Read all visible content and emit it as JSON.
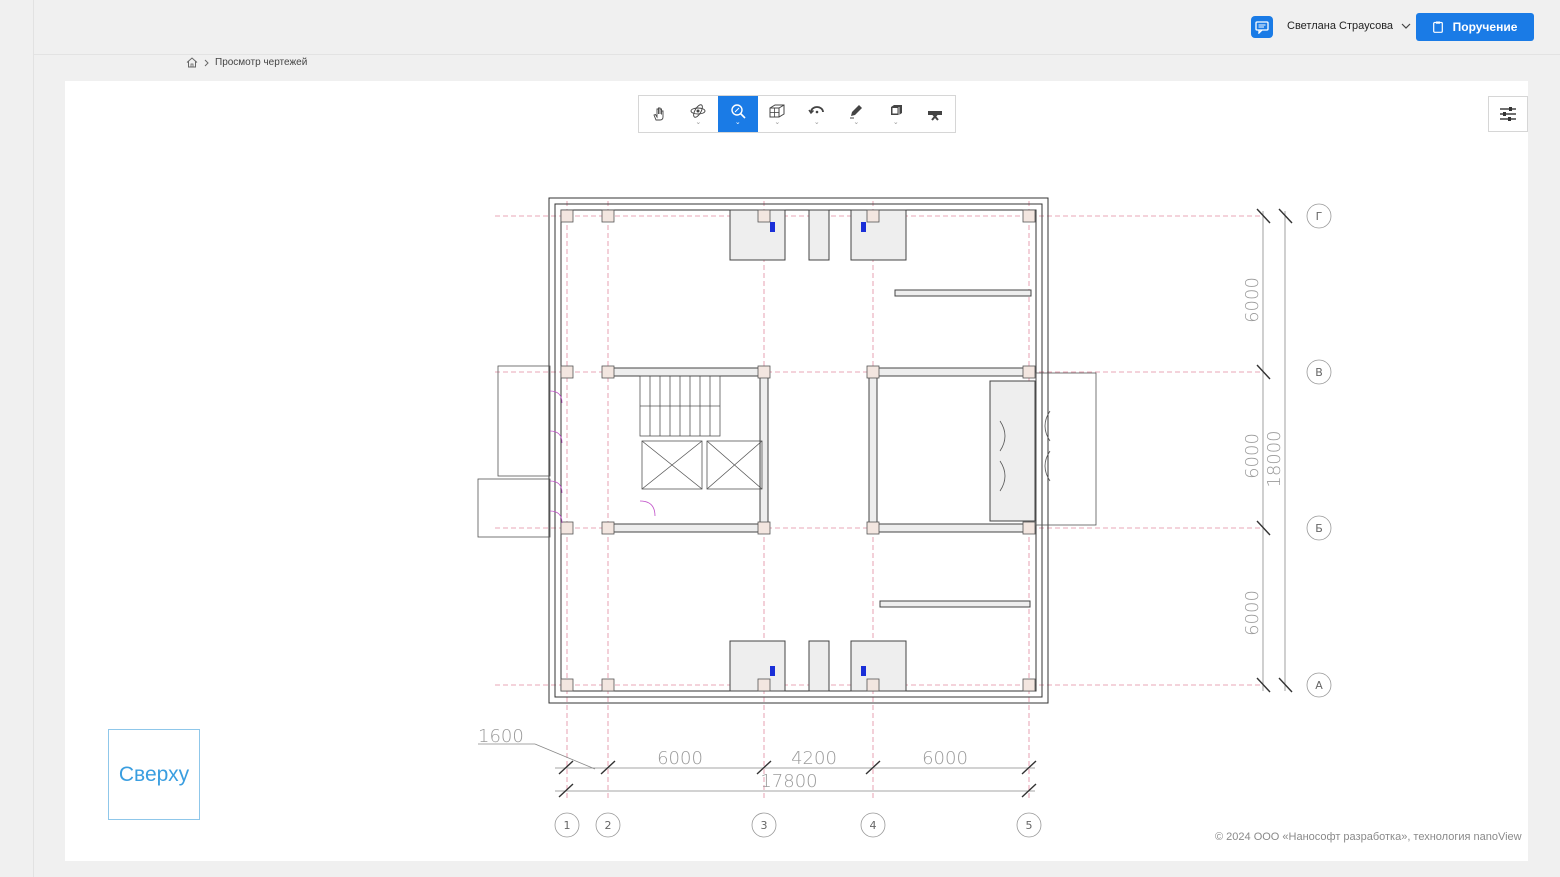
{
  "header": {
    "user_name": "Светлана Страусова",
    "task_button": "Поручение",
    "chat_icon": "chat-icon",
    "task_icon": "clipboard-icon"
  },
  "breadcrumb": {
    "home_icon": "home-icon",
    "current": "Просмотр чертежей"
  },
  "toolbar": {
    "tools": [
      {
        "name": "pan",
        "icon": "hand-icon",
        "has_menu": false,
        "active": false
      },
      {
        "name": "orbit",
        "icon": "orbit-icon",
        "has_menu": true,
        "active": false
      },
      {
        "name": "zoom",
        "icon": "zoom-icon",
        "has_menu": true,
        "active": true
      },
      {
        "name": "section",
        "icon": "section-box-icon",
        "has_menu": true,
        "active": false
      },
      {
        "name": "rotate",
        "icon": "rotate-icon",
        "has_menu": true,
        "active": false
      },
      {
        "name": "markup",
        "icon": "pen-icon",
        "has_menu": true,
        "active": false
      },
      {
        "name": "layers",
        "icon": "layers-icon",
        "has_menu": true,
        "active": false
      },
      {
        "name": "clear",
        "icon": "clear-icon",
        "has_menu": false,
        "active": false
      }
    ],
    "accent": "#1a7be6"
  },
  "viewcube": {
    "label": "Сверху"
  },
  "drawing": {
    "column_axes": [
      "1",
      "2",
      "3",
      "4",
      "5"
    ],
    "row_axes": [
      "Г",
      "В",
      "Б",
      "А"
    ],
    "dims_bottom": [
      "1600",
      "6000",
      "4200",
      "6000",
      "17800"
    ],
    "dims_right": [
      "6000",
      "6000",
      "6000",
      "18000"
    ]
  },
  "footer": {
    "copyright": "© 2024 ООО «Нанософт разработка», технология nanoView"
  }
}
